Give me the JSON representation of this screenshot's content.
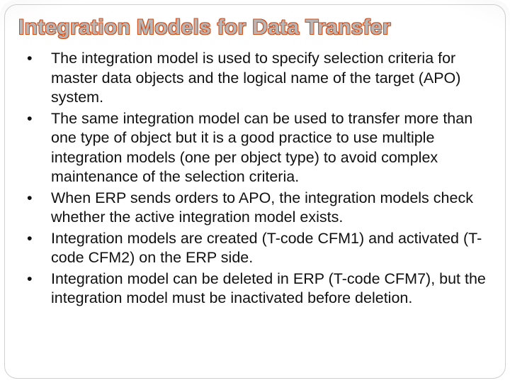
{
  "title": "Integration Models for Data Transfer",
  "bullets": [
    "The integration model is used to specify selection criteria for master data objects and the logical name of the target (APO) system.",
    "The same integration model can be used to transfer more than one type of object but it is a good practice to use multiple integration models (one per object type) to avoid complex maintenance of the selection criteria.",
    "When ERP sends orders to APO, the integration models check whether the active integration model exists.",
    "Integration models are created (T-code CFM1) and activated (T-code CFM2) on the ERP side.",
    "Integration model can be deleted in ERP (T-code CFM7), but the integration model must be inactivated before deletion."
  ]
}
